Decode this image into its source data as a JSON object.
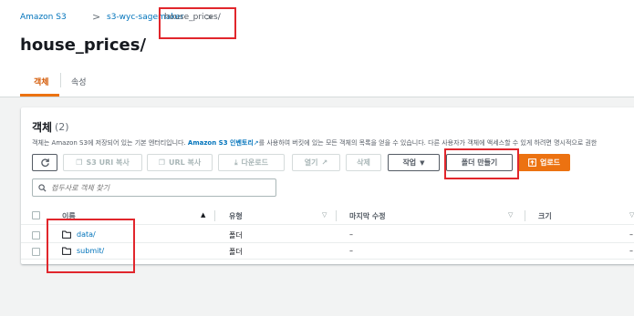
{
  "breadcrumb": {
    "items": [
      "Amazon S3",
      "s3-wyc-sagemaker",
      "house_prices/"
    ],
    "separator": ">"
  },
  "page": {
    "title": "house_prices/"
  },
  "tabs": [
    "객체",
    "속성"
  ],
  "panel": {
    "title": "객체",
    "count": "(2)",
    "description": {
      "prefix": "객체는 Amazon S3에 저장되어 있는 기본 엔터티입니다. ",
      "link": "Amazon S3 인벤토리",
      "suffix": "를 사용하여 버킷에 있는 모든 객체의 목록을 얻을 수 있습니다. 다른 사용자가 객체에 액세스할 수 있게 하려면 명시적으로 권한"
    }
  },
  "toolbar": {
    "refresh_icon": "refresh-icon",
    "copy_s3_uri": "S3 URI 복사",
    "copy_url": "URL 복사",
    "download": "다운로드",
    "open": "열기",
    "delete": "삭제",
    "actions": "작업",
    "create_folder": "폴더 만들기",
    "upload": "업로드"
  },
  "search": {
    "placeholder": "접두사로 객체 찾기"
  },
  "table": {
    "columns": [
      "이름",
      "유형",
      "마지막 수정",
      "크기"
    ],
    "rows": [
      {
        "name": "data/",
        "type": "폴더",
        "modified": "–",
        "size": "–"
      },
      {
        "name": "submit/",
        "type": "폴더",
        "modified": "–",
        "size": "–"
      }
    ]
  },
  "colors": {
    "accent": "#ec7211",
    "link": "#0073bb",
    "highlight": "#e1262c"
  }
}
